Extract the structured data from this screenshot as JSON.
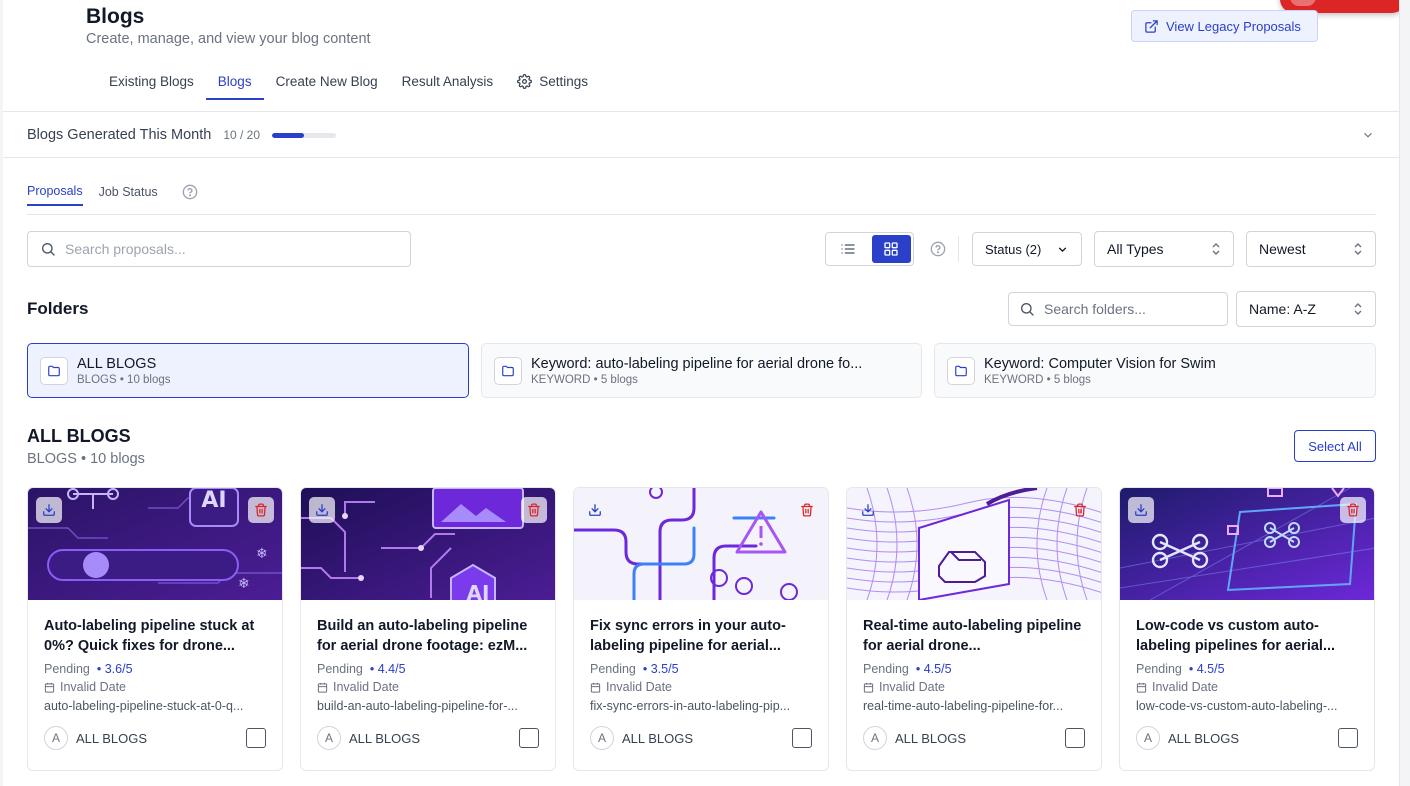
{
  "header": {
    "title": "Blogs",
    "subtitle": "Create, manage, and view your blog content",
    "legacy_button": "View Legacy Proposals"
  },
  "tabs": [
    {
      "label": "Existing Blogs",
      "active": false
    },
    {
      "label": "Blogs",
      "active": true
    },
    {
      "label": "Create New Blog",
      "active": false
    },
    {
      "label": "Result Analysis",
      "active": false
    },
    {
      "label": "Settings",
      "active": false,
      "icon": "gear-icon"
    }
  ],
  "quota": {
    "label": "Blogs Generated This Month",
    "count": "10 / 20",
    "progress": 0.5
  },
  "subtabs": [
    {
      "label": "Proposals",
      "active": true
    },
    {
      "label": "Job Status",
      "active": false
    }
  ],
  "toolbar": {
    "search_placeholder": "Search proposals...",
    "status_filter": "Status (2)",
    "type_filter": "All Types",
    "sort": "Newest",
    "view_mode": "grid"
  },
  "folders": {
    "title": "Folders",
    "search_placeholder": "Search folders...",
    "sort": "Name: A-Z",
    "items": [
      {
        "name": "ALL BLOGS",
        "meta": "BLOGS • 10 blogs",
        "active": true
      },
      {
        "name": "Keyword: auto-labeling pipeline for aerial drone fo...",
        "meta": "KEYWORD • 5 blogs",
        "active": false
      },
      {
        "name": "Keyword: Computer Vision for Swim",
        "meta": "KEYWORD • 5 blogs",
        "active": false
      }
    ]
  },
  "section": {
    "title": "ALL BLOGS",
    "meta": "BLOGS • 10 blogs",
    "select_all": "Select All"
  },
  "cards": [
    {
      "title": "Auto-labeling pipeline stuck at 0%? Quick fixes for drone...",
      "status": "Pending",
      "score": "• 3.6/5",
      "date": "Invalid Date",
      "slug": "auto-labeling-pipeline-stuck-at-0-q...",
      "avatar": "A",
      "folder": "ALL BLOGS"
    },
    {
      "title": "Build an auto-labeling pipeline for aerial drone footage: ezM...",
      "status": "Pending",
      "score": "• 4.4/5",
      "date": "Invalid Date",
      "slug": "build-an-auto-labeling-pipeline-for-...",
      "avatar": "A",
      "folder": "ALL BLOGS"
    },
    {
      "title": "Fix sync errors in your auto-labeling pipeline for aerial...",
      "status": "Pending",
      "score": "• 3.5/5",
      "date": "Invalid Date",
      "slug": "fix-sync-errors-in-auto-labeling-pip...",
      "avatar": "A",
      "folder": "ALL BLOGS"
    },
    {
      "title": "Real-time auto-labeling pipeline for aerial drone...",
      "status": "Pending",
      "score": "• 4.5/5",
      "date": "Invalid Date",
      "slug": "real-time-auto-labeling-pipeline-for...",
      "avatar": "A",
      "folder": "ALL BLOGS"
    },
    {
      "title": "Low-code vs custom auto-labeling pipelines for aerial...",
      "status": "Pending",
      "score": "• 4.5/5",
      "date": "Invalid Date",
      "slug": "low-code-vs-custom-auto-labeling-...",
      "avatar": "A",
      "folder": "ALL BLOGS"
    }
  ],
  "thumb_badges": [
    "AI",
    "AI"
  ],
  "colors": {
    "accent": "#2a40c8",
    "danger": "#dc2626",
    "thumb_dark": "#2a1466",
    "thumb_light": "#f4f2fb"
  }
}
